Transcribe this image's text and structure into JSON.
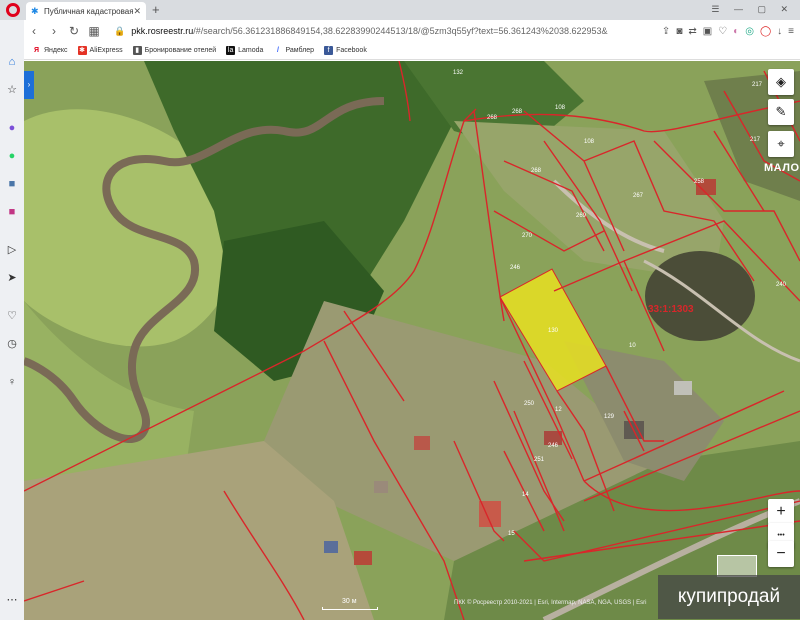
{
  "browser": {
    "tab_title": "Публичная кадастровая ка",
    "tab_close": "✕",
    "new_tab": "+",
    "url_domain": "pkk.rosreestr.ru",
    "url_path": "/#/search/56.361231886849154,38.62283990244513/18/@5zm3q55yf?text=56.361243%2038.622953&"
  },
  "bookmarks": [
    {
      "label": "Яндекс",
      "icon": "yandex-icon",
      "color": "#e0001b"
    },
    {
      "label": "AliExpress",
      "icon": "aliexpress-icon",
      "color": "#e43225"
    },
    {
      "label": "Бронирование отелей",
      "icon": "bookmark-icon",
      "color": "#555555"
    },
    {
      "label": "Lamoda",
      "icon": "lamoda-icon",
      "color": "#111111"
    },
    {
      "label": "Рамблер",
      "icon": "rambler-icon",
      "color": "#315efb"
    },
    {
      "label": "Facebook",
      "icon": "facebook-icon",
      "color": "#3b5998"
    }
  ],
  "map": {
    "place_label": "МАЛОВ",
    "quarter_number": "33:1:1303",
    "selected_parcel": "130",
    "scale": "30 м",
    "attribution": "ПКК © Росреестр 2010-2021 | Esri, Intermap, NASA, NGA, USGS | Esri",
    "watermark": "купипродай",
    "zoom_in": "+",
    "zoom_out": "−",
    "more": "•••",
    "parcel_labels": [
      "132",
      "268",
      "268",
      "108",
      "108",
      "268",
      "267",
      "258",
      "217",
      "217",
      "269",
      "270",
      "246",
      "130",
      "10",
      "240",
      "12",
      "129",
      "250",
      "246",
      "251",
      "14",
      "15"
    ]
  },
  "colors": {
    "boundary": "#d9262a",
    "selected_fill": "#e8e021",
    "accent": "#1d6fd8"
  }
}
